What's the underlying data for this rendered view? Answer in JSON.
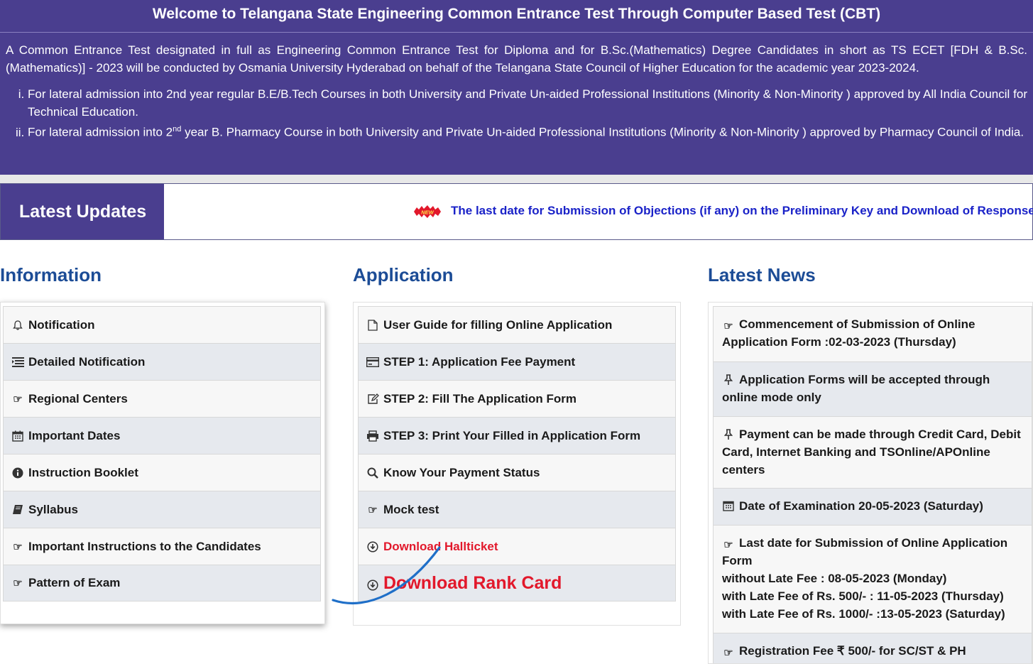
{
  "header": {
    "title": "Welcome to Telangana State Engineering Common Entrance Test Through Computer Based Test (CBT)",
    "intro": "A Common Entrance Test designated in full as Engineering Common Entrance Test for Diploma and for B.Sc.(Mathematics) Degree Candidates in short as TS ECET [FDH & B.Sc.(Mathematics)] - 2023 will be conducted by Osmania University Hyderabad on behalf of the Telangana State Council of Higher Education for the academic year 2023-2024.",
    "points": [
      {
        "text": "For lateral admission into 2nd year regular B.E/B.Tech Courses in both University and Private Un-aided Professional Institutions (Minority & Non-Minority ) approved by All India Council for Technical Education."
      },
      {
        "pre": "For lateral admission into 2",
        "sup": "nd",
        "post": " year B. Pharmacy Course in both University and Private Un-aided Professional Institutions (Minority & Non-Minority ) approved by Pharmacy Council of India."
      }
    ]
  },
  "updates": {
    "label": "Latest Updates",
    "badge": "NEW",
    "ticker": "The last date for Submission of Objections (if any) on the Preliminary Key and Download of Response Sheets"
  },
  "information": {
    "heading": "Information",
    "items": [
      {
        "label": "Notification",
        "icon": "bell-icon"
      },
      {
        "label": "Detailed Notification",
        "icon": "list-icon"
      },
      {
        "label": "Regional Centers",
        "icon": "hand-point-right-icon"
      },
      {
        "label": "Important Dates",
        "icon": "calendar-icon"
      },
      {
        "label": "Instruction Booklet",
        "icon": "info-circle-icon"
      },
      {
        "label": "Syllabus",
        "icon": "book-icon"
      },
      {
        "label": "Important Instructions to the Candidates",
        "icon": "hand-point-right-icon"
      },
      {
        "label": "Pattern of Exam",
        "icon": "hand-point-right-icon"
      }
    ]
  },
  "application": {
    "heading": "Application",
    "items": [
      {
        "label": "User Guide for filling Online Application",
        "icon": "file-icon"
      },
      {
        "label": "STEP 1: Application Fee Payment",
        "icon": "credit-card-icon"
      },
      {
        "label": "STEP 2: Fill The Application Form",
        "icon": "edit-icon"
      },
      {
        "label": "STEP 3: Print Your Filled in Application Form",
        "icon": "print-icon"
      },
      {
        "label": "Know Your Payment Status",
        "icon": "search-icon"
      },
      {
        "label": "Mock test",
        "icon": "hand-point-right-icon"
      },
      {
        "label": "Download Hallticket",
        "icon": "download-circle-icon"
      },
      {
        "label": "Download Rank Card",
        "icon": "download-circle-icon"
      }
    ]
  },
  "news": {
    "heading": "Latest News",
    "items": [
      {
        "lines": [
          "Commencement of Submission of Online Application Form :02-03-2023 (Thursday)"
        ],
        "icon": "hand-point-right-icon"
      },
      {
        "lines": [
          "Application Forms will be accepted through online mode only"
        ],
        "icon": "pin-icon"
      },
      {
        "lines": [
          "Payment can be made through Credit Card, Debit Card, Internet Banking and TSOnline/APOnline centers"
        ],
        "icon": "pin-icon"
      },
      {
        "lines": [
          "Date of Examination 20-05-2023 (Saturday)"
        ],
        "icon": "calendar-icon"
      },
      {
        "lines": [
          "Last date for Submission of Online Application Form",
          "without Late Fee : 08-05-2023 (Monday)",
          "with Late Fee of Rs. 500/- : 11-05-2023 (Thursday)",
          "with Late Fee of Rs. 1000/- :13-05-2023 (Saturday)"
        ],
        "icon": "hand-point-right-icon"
      },
      {
        "lines": [
          "Registration Fee ₹ 500/- for SC/ST & PH"
        ],
        "icon": "hand-point-right-icon"
      }
    ]
  },
  "colors": {
    "band": "#4a3e8f",
    "heading": "#1c4c96",
    "link_red": "#e2182b",
    "ticker": "#1a22c8"
  }
}
